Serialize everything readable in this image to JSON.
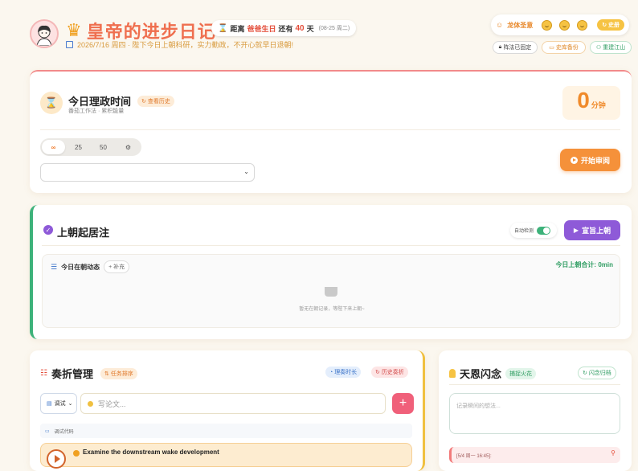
{
  "header": {
    "app_title": "皇帝的进步日记",
    "birthday": {
      "prefix": "距离",
      "who": "爸爸生日",
      "mid": "还有",
      "days": "40",
      "suffix": "天",
      "date": "(08-25 周二)"
    },
    "date_line": "2026/7/16 周四 · 陛下今日上朝科研，实力勤政，不开心就早日退朝!"
  },
  "top_right": {
    "mood_label": "龙体圣意",
    "history_pill": "史册",
    "buttons": [
      "阵法已固定",
      "史库备份",
      "重建江山"
    ]
  },
  "focus_card": {
    "title": "今日理政时间",
    "history_tag": "查看历史",
    "subtitle": "番茄工作法 · 累积能量",
    "timer_value": "0",
    "timer_unit": "分钟",
    "segments": [
      "∞",
      "25",
      "50",
      "⚙"
    ],
    "active_segment": "∞",
    "select_value": "",
    "start_button": "开始审阅"
  },
  "court_card": {
    "title": "上朝起居注",
    "auto_detect": "自动检测",
    "auto_detect_on": true,
    "start_button": "宣旨上朝",
    "inner_title": "今日在朝动态",
    "add_tag": "补充",
    "total": "今日上朝合计: 0min",
    "empty_text": "暂无在朝记录，等陛下来上朝~"
  },
  "memorial_card": {
    "title": "奏折管理",
    "sort_tag": "任务排序",
    "stats_tag": "理奏时长",
    "history_tag": "历史奏折",
    "dropdown_value": "调试",
    "input_placeholder": "写论文...",
    "add_button": "+",
    "group_label": "调试代码",
    "task_text": "Examine the downstream wake development"
  },
  "idea_card": {
    "title": "天恩闪念",
    "tag": "捕捉火花",
    "archive_tag": "闪念归档",
    "input_placeholder": "记录瞬间的想法...",
    "memo_time": "[5/4 周一 16:45]:"
  },
  "colors": {
    "accent_orange": "#f5913a",
    "accent_purple": "#8e5ad8",
    "accent_green": "#3db27a",
    "title_red": "#ef6f4f"
  }
}
